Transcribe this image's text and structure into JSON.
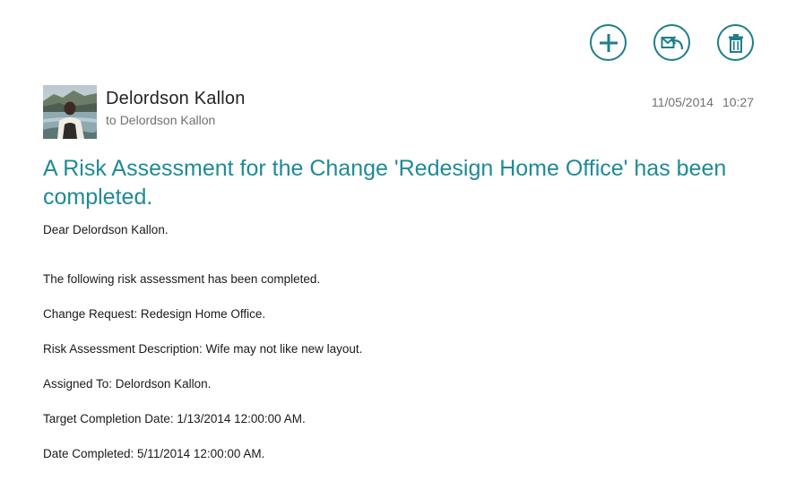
{
  "toolbar": {
    "new_icon": "plus-icon",
    "respond_icon": "reply-icon",
    "delete_icon": "trash-icon",
    "accent_color": "#1f7e89"
  },
  "message": {
    "sender": "Delordson Kallon",
    "recipient_prefix": "to",
    "recipient": "Delordson Kallon",
    "date": "11/05/2014",
    "time": "10:27",
    "subject": "A Risk Assessment for the Change 'Redesign Home Office' has been completed.",
    "subject_color": "#1f8a96",
    "body": [
      "Dear Delordson Kallon.",
      "The following risk assessment has been completed.",
      "Change Request: Redesign Home Office.",
      "Risk Assessment Description: Wife may not like new layout.",
      "Assigned To: Delordson Kallon.",
      "Target Completion Date: 1/13/2014 12:00:00 AM.",
      "Date Completed: 5/11/2014 12:00:00 AM."
    ]
  }
}
